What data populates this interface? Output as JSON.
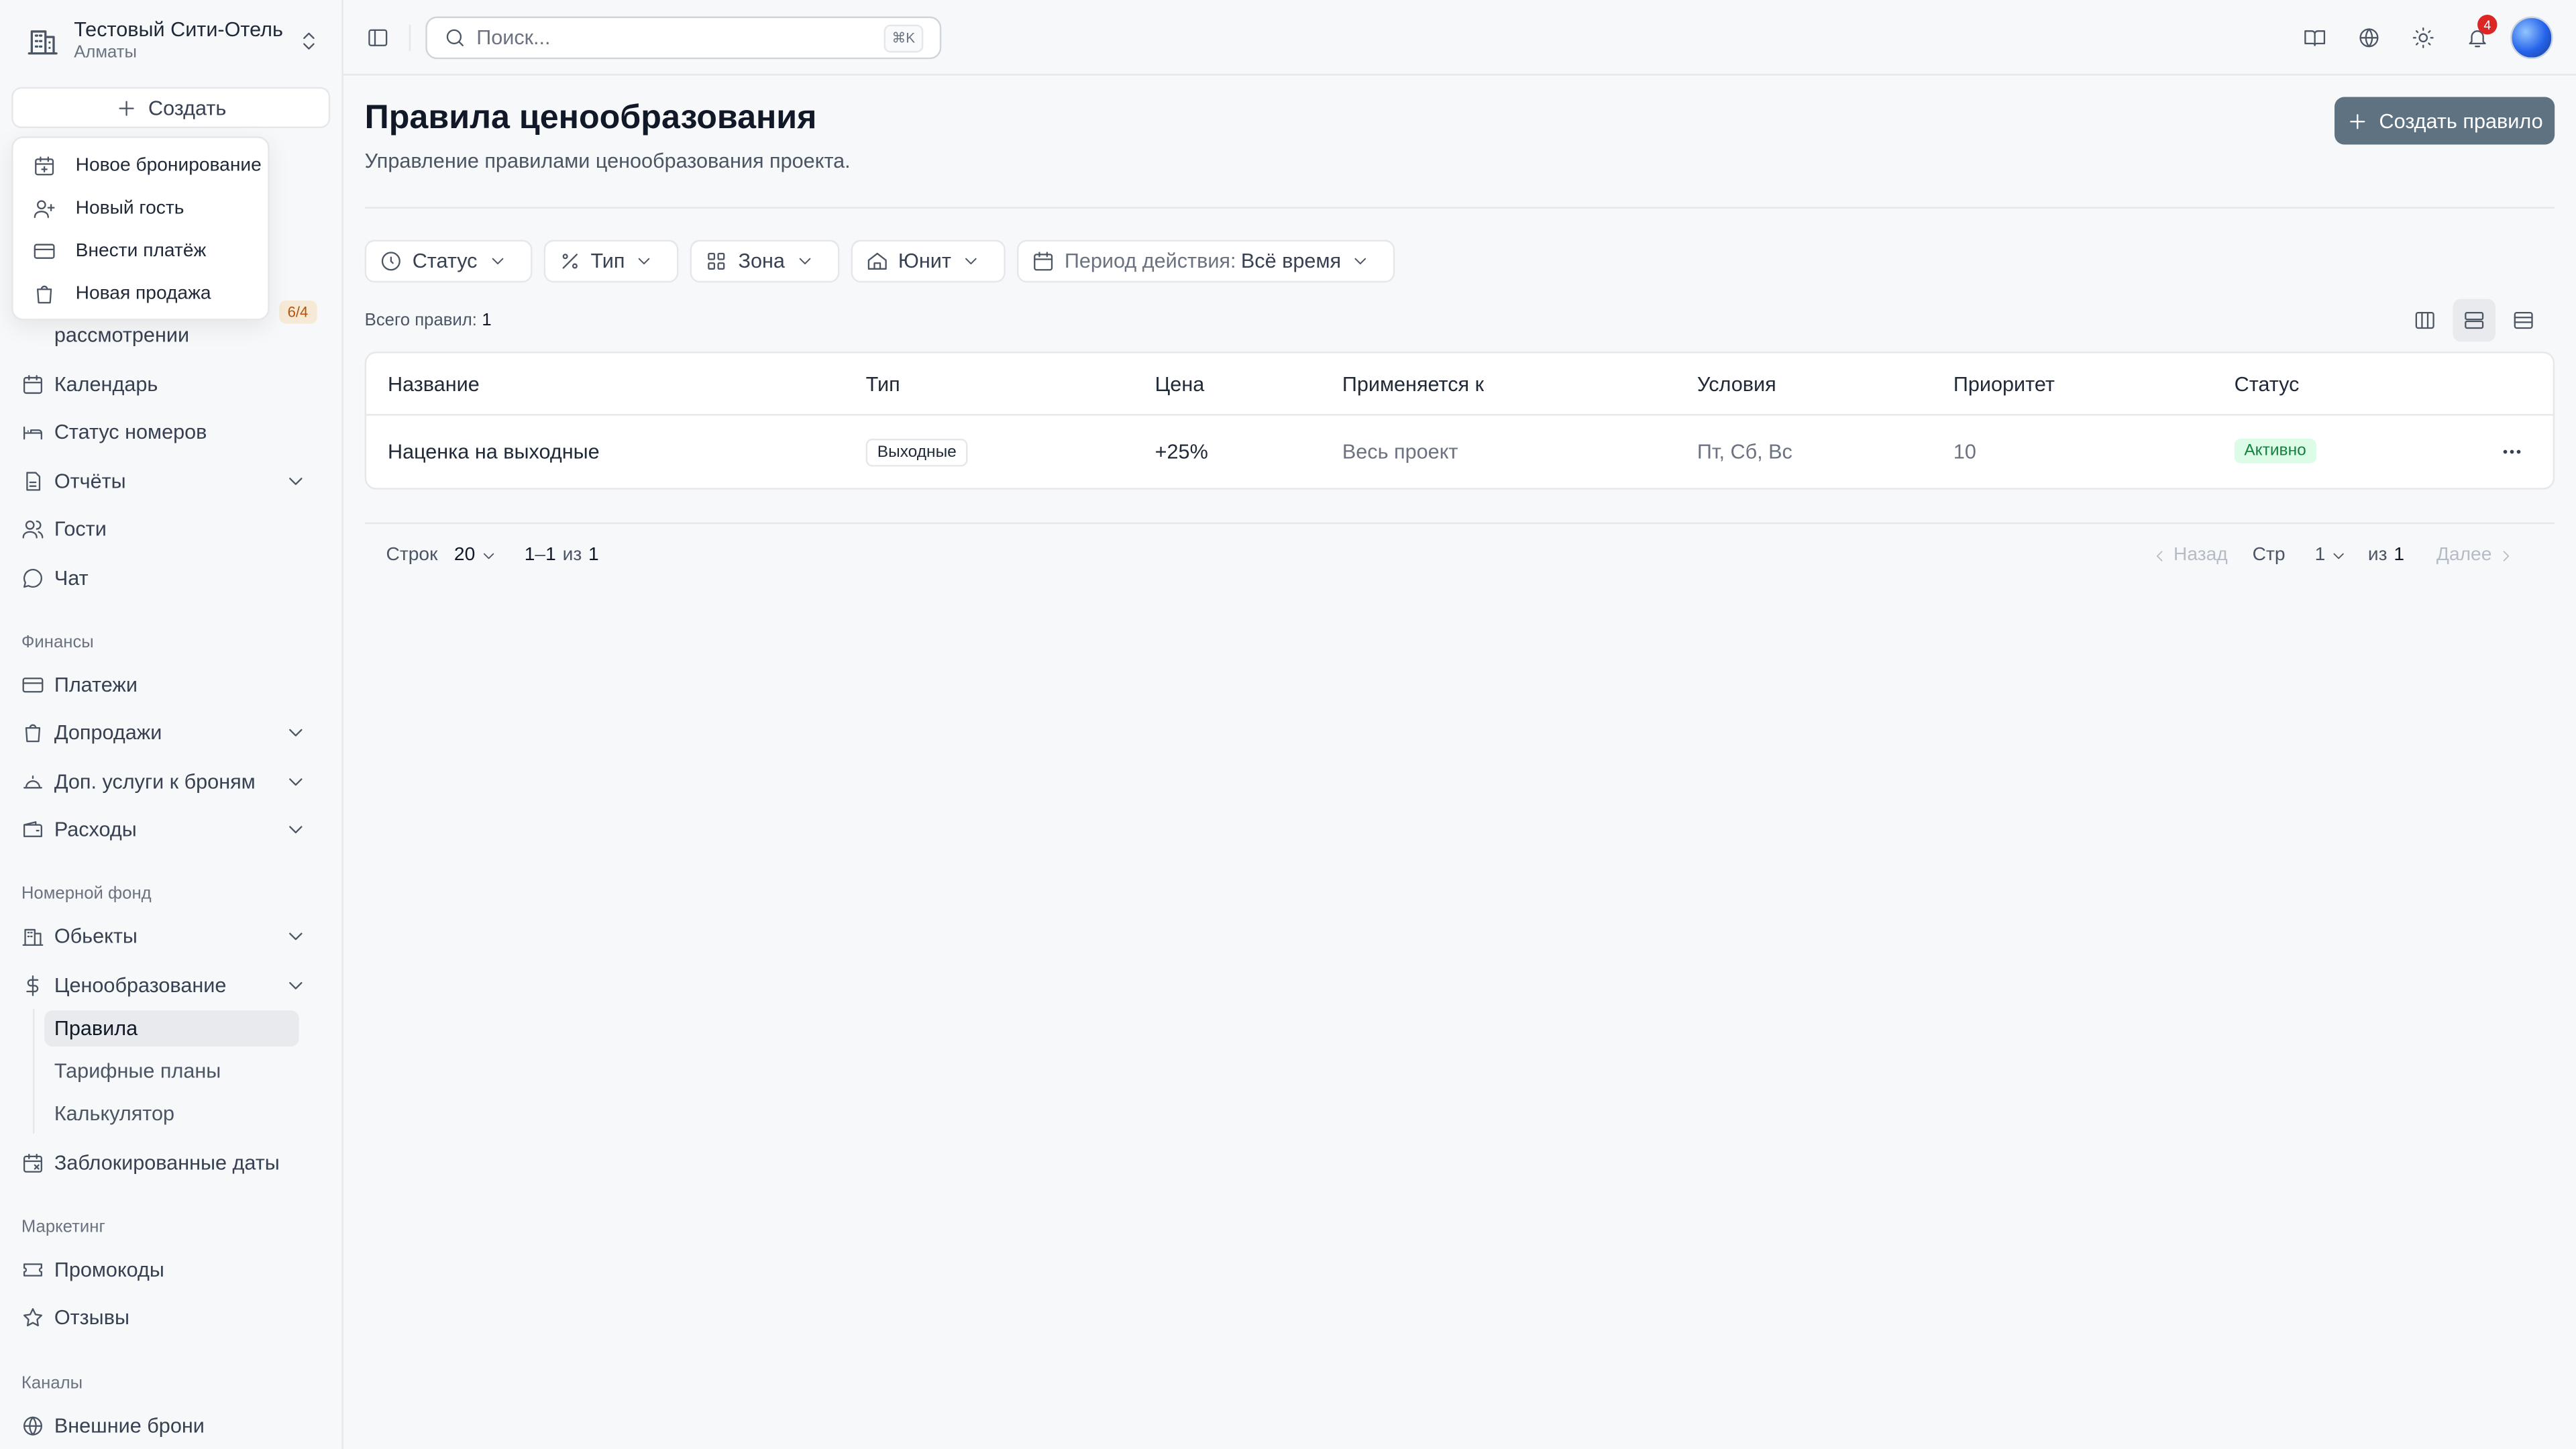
{
  "org": {
    "name": "Тестовый Сити-Отель",
    "city": "Алматы"
  },
  "sidebar": {
    "create_label": "Создать",
    "dropdown": [
      {
        "label": "Новое бронирование",
        "icon": "calendar-plus-icon"
      },
      {
        "label": "Новый гость",
        "icon": "user-plus-icon"
      },
      {
        "label": "Внести платёж",
        "icon": "credit-card-icon"
      },
      {
        "label": "Новая продажа",
        "icon": "shopping-bag-icon"
      }
    ],
    "partial_item": "рассмотрении",
    "partial_badge": "6/4",
    "items": [
      {
        "label": "Календарь",
        "icon": "calendar-icon"
      },
      {
        "label": "Статус номеров",
        "icon": "bed-icon"
      },
      {
        "label": "Отчёты",
        "icon": "report-icon"
      },
      {
        "label": "Гости",
        "icon": "users-icon"
      },
      {
        "label": "Чат",
        "icon": "chat-icon"
      }
    ],
    "sections": {
      "finance": "Финансы",
      "rooms": "Номерной фонд",
      "marketing": "Маркетинг",
      "channels": "Каналы"
    },
    "finance_items": [
      {
        "label": "Платежи",
        "icon": "credit-card-icon"
      },
      {
        "label": "Допродажи",
        "icon": "shopping-bag-icon"
      },
      {
        "label": "Доп. услуги к броням",
        "icon": "service-bell-icon"
      },
      {
        "label": "Расходы",
        "icon": "wallet-icon"
      }
    ],
    "room_items": [
      {
        "label": "Обьекты",
        "icon": "building-icon"
      },
      {
        "label": "Ценообразование",
        "icon": "dollar-icon"
      }
    ],
    "pricing_sub": [
      "Правила",
      "Тарифные планы",
      "Калькулятор"
    ],
    "blocked": "Заблокированные даты",
    "marketing_items": [
      {
        "label": "Промокоды",
        "icon": "ticket-icon"
      },
      {
        "label": "Отзывы",
        "icon": "star-icon"
      }
    ],
    "channel_items": [
      {
        "label": "Внешние брони",
        "icon": "globe-icon"
      }
    ]
  },
  "topbar": {
    "search_placeholder": "Поиск...",
    "shortcut": "⌘K",
    "notifications_count": "4"
  },
  "main": {
    "title": "Правила ценообразования",
    "subtitle": "Управление правилами ценообразования проекта.",
    "create_rule_label": "Создать правило",
    "filters": {
      "status": "Статус",
      "type": "Тип",
      "zone": "Зона",
      "unit": "Юнит",
      "period_label": "Период действия:",
      "period_value": "Всё время"
    },
    "total_label": "Всего правил:",
    "total_value": "1",
    "table": {
      "headers": [
        "Название",
        "Тип",
        "Цена",
        "Применяется к",
        "Условия",
        "Приоритет",
        "Статус"
      ],
      "rows": [
        {
          "name": "Наценка на выходные",
          "type": "Выходные",
          "price": "+25%",
          "applies_to": "Весь проект",
          "conditions": "Пт, Сб, Вс",
          "priority": "10",
          "status": "Активно"
        }
      ]
    },
    "pagination": {
      "rows_label": "Строк",
      "rows_value": "20",
      "range_start": "1",
      "range_dash": "–",
      "range_end": "1",
      "of_label": "из",
      "total": "1",
      "prev": "Назад",
      "page_label": "Стр",
      "page_value": "1",
      "page_of": "из",
      "page_total": "1",
      "next": "Далее"
    }
  },
  "colors": {
    "primary_button": "#5f7282",
    "active_status_bg": "#dcfce7",
    "active_status_text": "#15803d",
    "notification_badge": "#dc2626"
  }
}
